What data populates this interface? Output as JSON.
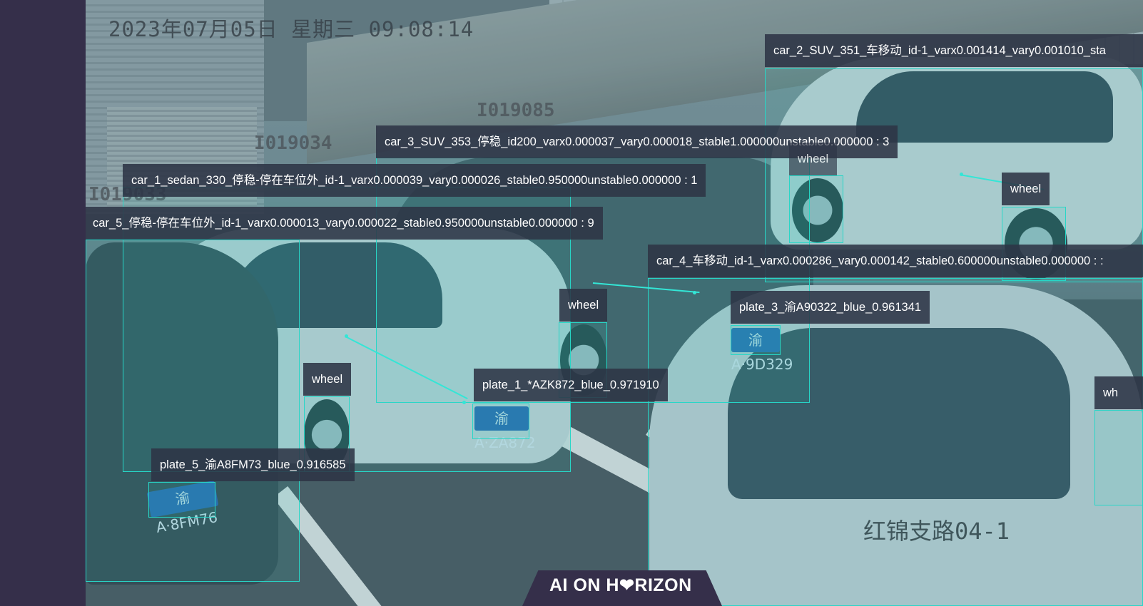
{
  "osd": {
    "datetime": "2023年07月05日  星期三  09:08:14",
    "camera": "红锦支路04-1",
    "id_tags": [
      "I019034",
      "I019085",
      "I019033"
    ]
  },
  "detections": {
    "car_1": "car_1_sedan_330_停稳-停在车位外_id-1_varx0.000039_vary0.000026_stable0.950000unstable0.000000 : 1",
    "car_2": "car_2_SUV_351_车移动_id-1_varx0.001414_vary0.001010_sta",
    "car_3": "car_3_SUV_353_停稳_id200_varx0.000037_vary0.000018_stable1.000000unstable0.000000 : 3",
    "car_4": "car_4_车移动_id-1_varx0.000286_vary0.000142_stable0.600000unstable0.000000 : :",
    "car_5": "car_5_停稳-停在车位外_id-1_varx0.000013_vary0.000022_stable0.950000unstable0.000000 : 9",
    "plate_1": "plate_1_*AZK872_blue_0.971910",
    "plate_3": "plate_3_渝A90322_blue_0.961341",
    "plate_5": "plate_5_渝A8FM73_blue_0.916585",
    "wheel": "wheel",
    "wheel_cut": "wh"
  },
  "plates_in_scene": {
    "p1": "渝A·ZA872",
    "p3": "渝A·9D329",
    "p5": "渝A·8FM76"
  },
  "brand": {
    "logo": "AI ON H❤RIZON"
  },
  "colors": {
    "box": "#28d6c7",
    "label_bg": "#2d3446",
    "sidebar": "#352f4a"
  }
}
